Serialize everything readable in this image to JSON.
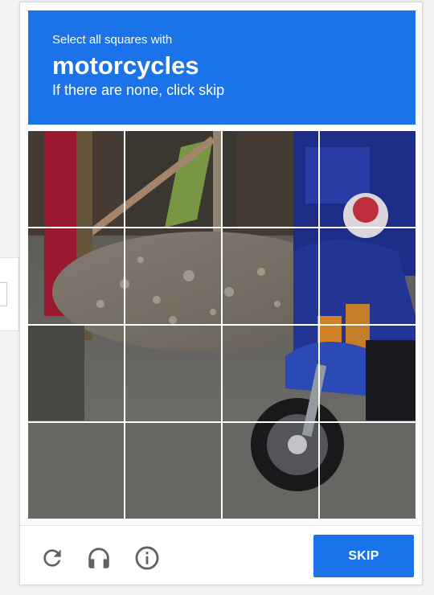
{
  "header": {
    "select_text": "Select all squares with",
    "target": "motorcycles",
    "hint": "If there are none, click skip",
    "color": "#1a73e8"
  },
  "grid": {
    "rows": 4,
    "columns": 4,
    "tile_count": 16
  },
  "footer": {
    "icons": [
      "reload-icon",
      "audio-headphones-icon",
      "info-icon"
    ],
    "skip_label": "SKIP",
    "skip_color": "#1a73e8"
  }
}
